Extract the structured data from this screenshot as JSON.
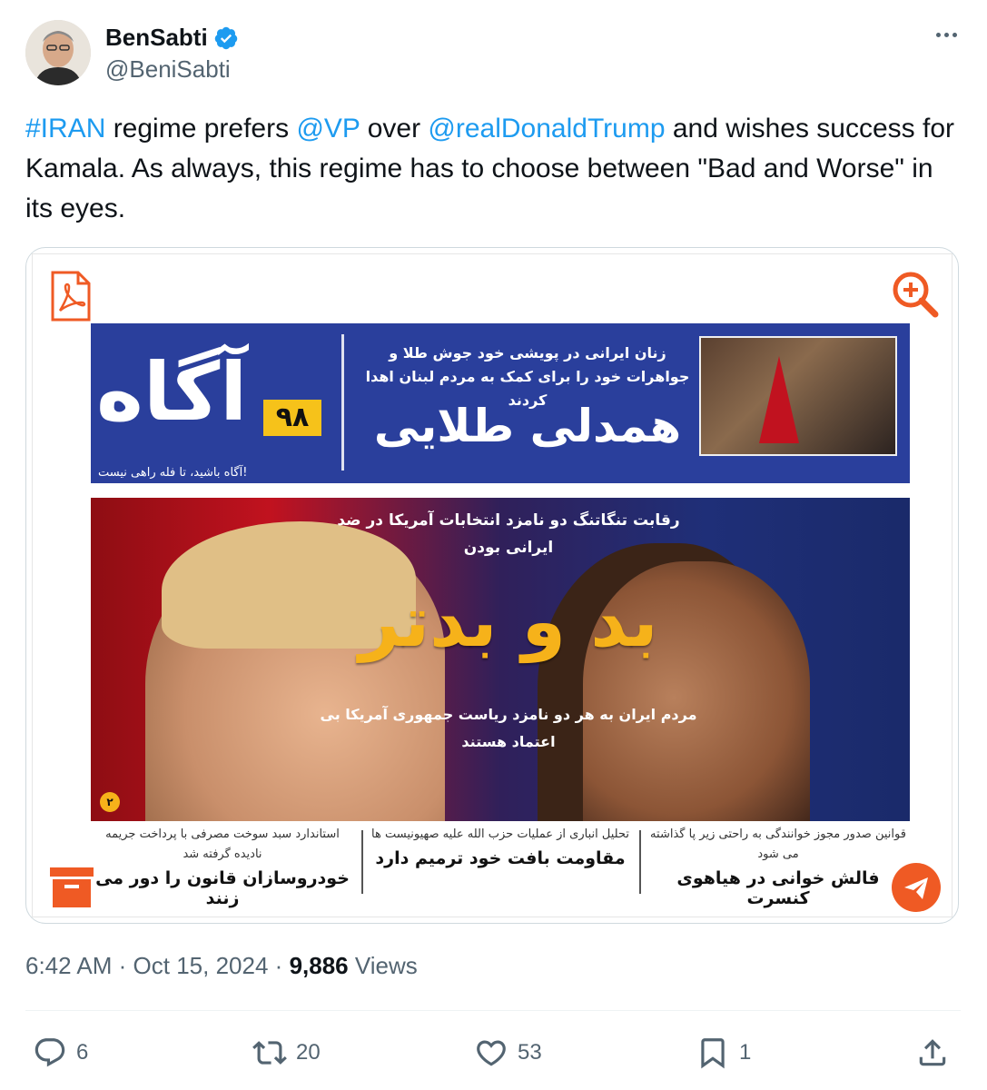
{
  "author": {
    "display_name": "BenSabti",
    "handle": "@BeniSabti",
    "verified_icon": "verified-badge-icon"
  },
  "tweet": {
    "segments": [
      {
        "text": "#IRAN",
        "link": true
      },
      {
        "text": " regime prefers ",
        "link": false
      },
      {
        "text": "@VP",
        "link": true
      },
      {
        "text": " over ",
        "link": false
      },
      {
        "text": "@realDonaldTrump",
        "link": true
      },
      {
        "text": " and wishes success for Kamala. As always, this regime has to choose between \"Bad and Worse\" in its eyes.",
        "link": false
      }
    ]
  },
  "media": {
    "masthead": {
      "logo": "آگاه",
      "issue_number": "۹۸",
      "tagline": "آگاه باشید، تا فله راهی نیست!",
      "headline_sub": "زنان ایرانی در پویشی خود جوش طلا و جواهرات خود را برای کمک به مردم لبنان اهدا کردند",
      "headline_main": "همدلی طلایی"
    },
    "cover": {
      "top_text": "رقابت تنگاتنگ دو نامزد انتخابات آمریکا در ضد ایرانی بودن",
      "main_text": "بد و بدتر",
      "sub_text": "مردم ایران به هر دو نامزد ریاست جمهوری آمریکا بی اعتماد هستند",
      "page_num": "۲"
    },
    "columns": [
      {
        "sub": "استاندارد سبد سوخت مصرفی با پرداخت جریمه نادیده گرفته شد",
        "main": "خودروسازان قانون را دور می زنند"
      },
      {
        "sub": "تحلیل انباری از عملیات حزب الله علیه صهیونیست ها",
        "main": "مقاومت بافت خود ترمیم دارد"
      },
      {
        "sub": "قوانین صدور مجوز خوانندگی به راحتی زیر پا گذاشته می شود",
        "main": "فالش خوانی در هیاهوی کنسرت"
      }
    ]
  },
  "meta": {
    "time": "6:42 AM",
    "date": "Oct 15, 2024",
    "views_count": "9,886",
    "views_label": "Views"
  },
  "actions": {
    "reply_count": "6",
    "retweet_count": "20",
    "like_count": "53",
    "bookmark_count": "1"
  },
  "colors": {
    "link": "#1d9bf0",
    "verified": "#1d9bf0",
    "muted": "#536471",
    "masthead_blue": "#2a3f9c",
    "accent_orange": "#ef5a24"
  }
}
